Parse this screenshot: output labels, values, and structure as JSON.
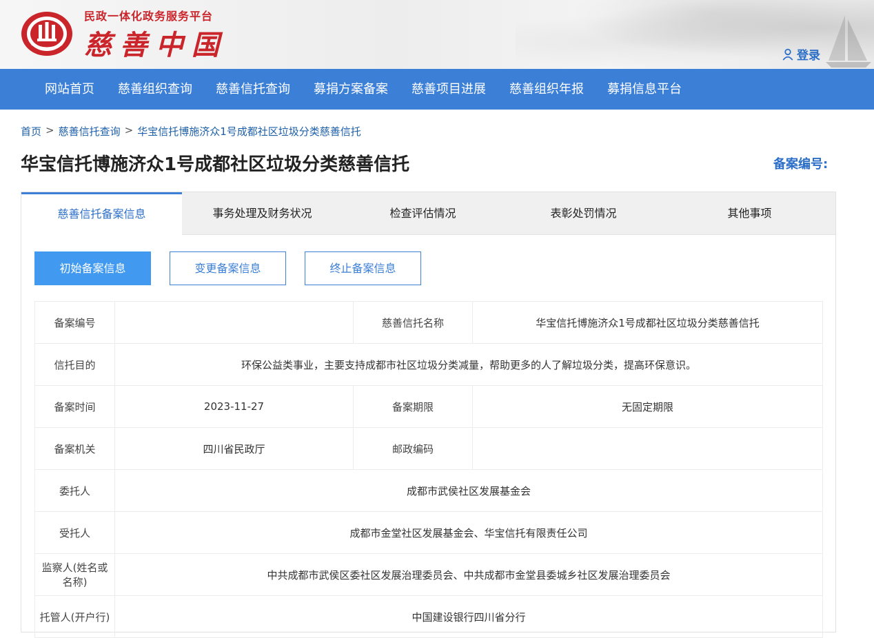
{
  "header": {
    "subtitle": "民政一体化政务服务平台",
    "title": "慈善中国",
    "login_label": "登录",
    "brand_color": "#c9252b",
    "accent_color": "#3b7fd6"
  },
  "nav": {
    "items": [
      "网站首页",
      "慈善组织查询",
      "慈善信托查询",
      "募捐方案备案",
      "慈善项目进展",
      "慈善组织年报",
      "募捐信息平台"
    ]
  },
  "breadcrumb": {
    "items": [
      "首页",
      "慈善信托查询",
      "华宝信托博施济众1号成都社区垃圾分类慈善信托"
    ],
    "separator": ">"
  },
  "page": {
    "title": "华宝信托博施济众1号成都社区垃圾分类慈善信托",
    "record_number_label": "备案编号:"
  },
  "tabs": {
    "items": [
      "慈善信托备案信息",
      "事务处理及财务状况",
      "检查评估情况",
      "表彰处罚情况",
      "其他事项"
    ],
    "active_index": 0
  },
  "sub_buttons": {
    "items": [
      "初始备案信息",
      "变更备案信息",
      "终止备案信息"
    ],
    "active_index": 0
  },
  "table": {
    "record_no_label": "备案编号",
    "record_no_value": "",
    "trust_name_label": "慈善信托名称",
    "trust_name_value": "华宝信托博施济众1号成都社区垃圾分类慈善信托",
    "purpose_label": "信托目的",
    "purpose_value": "环保公益类事业，主要支持成都市社区垃圾分类减量，帮助更多的人了解垃圾分类，提高环保意识。",
    "record_time_label": "备案时间",
    "record_time_value": "2023-11-27",
    "record_term_label": "备案期限",
    "record_term_value": "无固定期限",
    "record_authority_label": "备案机关",
    "record_authority_value": "四川省民政厅",
    "postal_code_label": "邮政编码",
    "postal_code_value": "",
    "settlor_label": "委托人",
    "settlor_value": "成都市武侯社区发展基金会",
    "trustee_label": "受托人",
    "trustee_value": "成都市金堂社区发展基金会、华宝信托有限责任公司",
    "supervisor_label": "监察人(姓名或名称)",
    "supervisor_value": "中共成都市武侯区委社区发展治理委员会、中共成都市金堂县委城乡社区发展治理委员会",
    "custodian_label": "托管人(开户行)",
    "custodian_value": "中国建设银行四川省分行"
  }
}
